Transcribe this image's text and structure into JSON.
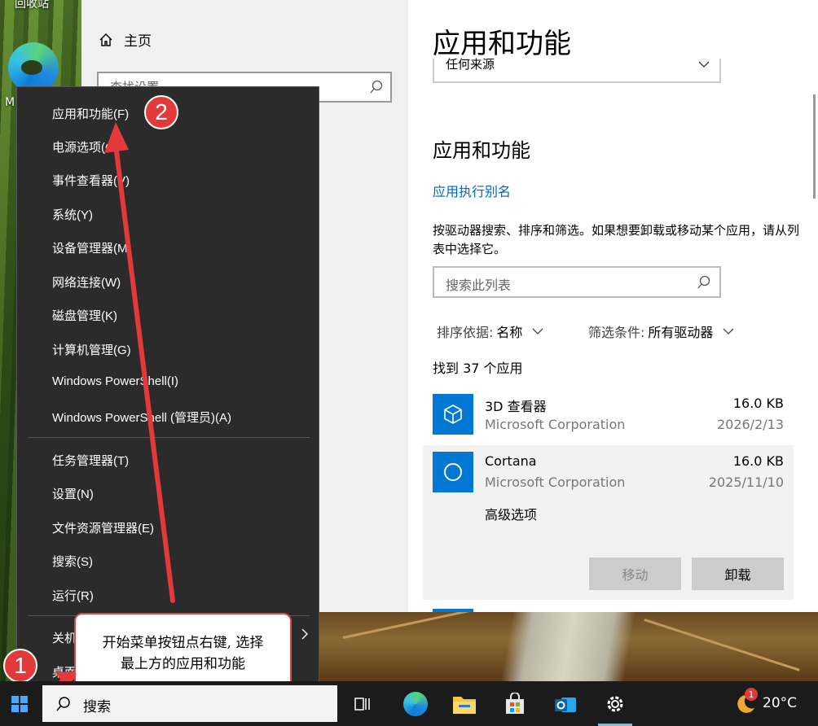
{
  "desktop": {
    "recycle_bin_label": "回收站",
    "edge_label_fragment": "M"
  },
  "settings": {
    "nav": {
      "home_label": "主页",
      "search_placeholder": "查找设置"
    },
    "main": {
      "title": "应用和功能",
      "source_select_value": "任何来源",
      "section_title": "应用和功能",
      "alias_link": "应用执行别名",
      "description": "按驱动器搜索、排序和筛选。如果想要卸载或移动某个应用，请从列表中选择它。",
      "list_search_placeholder": "搜索此列表",
      "sort_label": "排序依据:",
      "sort_value": "名称",
      "filter_label": "筛选条件:",
      "filter_value": "所有驱动器",
      "found_text": "找到 37 个应用",
      "apps": [
        {
          "name": "3D 查看器",
          "publisher": "Microsoft Corporation",
          "size": "16.0 KB",
          "date": "2026/2/13"
        },
        {
          "name": "Cortana",
          "publisher": "Microsoft Corporation",
          "size": "16.0 KB",
          "date": "2025/11/10",
          "advanced": "高级选项",
          "move_label": "移动",
          "uninstall_label": "卸载"
        }
      ]
    }
  },
  "context_menu": {
    "items": [
      "应用和功能(F)",
      "电源选项(O)",
      "事件查看器(V)",
      "系统(Y)",
      "设备管理器(M)",
      "网络连接(W)",
      "磁盘管理(K)",
      "计算机管理(G)",
      "Windows PowerShell(I)",
      "Windows PowerShell (管理员)(A)",
      "任务管理器(T)",
      "设置(N)",
      "文件资源管理器(E)",
      "搜索(S)",
      "运行(R)",
      "关机",
      "桌面"
    ]
  },
  "annotations": {
    "badge_1": "1",
    "badge_2": "2",
    "callout_line1": "开始菜单按钮点右键, 选择",
    "callout_line2": "最上方的应用和功能"
  },
  "taskbar": {
    "search_placeholder": "搜索",
    "icons": [
      "task-view-icon",
      "edge-icon",
      "file-explorer-icon",
      "store-icon",
      "outlook-icon",
      "settings-icon"
    ],
    "weather_badge": "1",
    "temperature": "20°C"
  },
  "colors": {
    "accent": "#0078d4",
    "link": "#0067c0",
    "annotation_red": "#e23a3a",
    "menu_bg": "#2b2b2b",
    "taskbar_bg": "#1b1b1b"
  }
}
